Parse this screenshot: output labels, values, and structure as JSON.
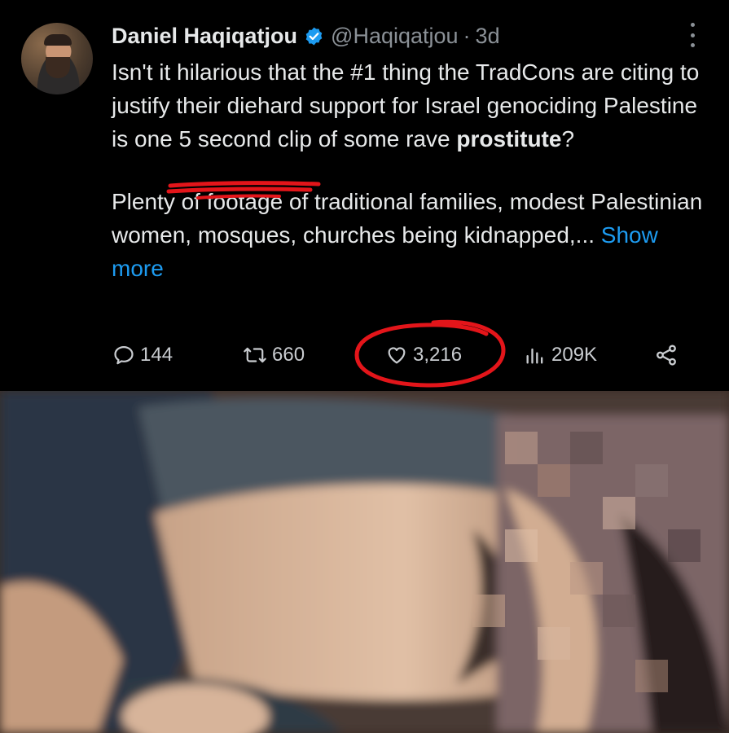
{
  "tweet": {
    "author": {
      "name": "Daniel Haqiqatjou",
      "handle": "@Haqiqatjou",
      "separator": "·",
      "time": "3d",
      "verified": true,
      "verified_color": "#1d9bf0"
    },
    "text": {
      "p1_before": "Isn't it hilarious that the #1 thing the TradCons are citing to justify their diehard support for Israel genociding Palestine is one 5 second clip of some rave ",
      "p1_bold": "prostitute",
      "p1_after": "?",
      "p2_text": "Plenty of footage of traditional families, modest Palestinian women, mosques, churches being kidnapped,... ",
      "show_more": "Show more"
    },
    "actions": {
      "replies": "144",
      "reposts": "660",
      "likes": "3,216",
      "views": "209K"
    },
    "icons": {
      "reply": "reply-icon",
      "repost": "repost-icon",
      "like": "heart-icon",
      "views": "analytics-icon",
      "share": "share-icon",
      "more": "more-options-icon"
    },
    "annotation_color": "#e3151a",
    "link_color": "#1d9bf0"
  }
}
